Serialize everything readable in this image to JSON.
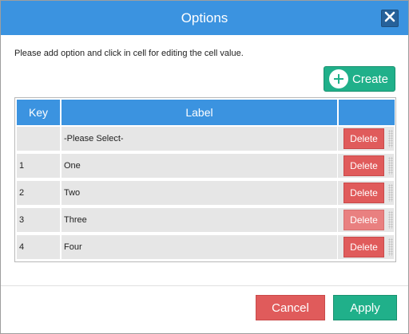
{
  "dialog": {
    "title": "Options",
    "instructions": "Please add option and click in cell for editing the cell value.",
    "create_label": "Create",
    "cancel_label": "Cancel",
    "apply_label": "Apply",
    "close_icon": "close-icon",
    "create_icon": "plus-circle-icon"
  },
  "table": {
    "headers": [
      "Key",
      "Label",
      ""
    ],
    "rows": [
      {
        "key": "",
        "label": "-Please Select-",
        "action": "Delete"
      },
      {
        "key": "1",
        "label": "One",
        "action": "Delete"
      },
      {
        "key": "2",
        "label": "Two",
        "action": "Delete"
      },
      {
        "key": "3",
        "label": "Three",
        "action": "Delete"
      },
      {
        "key": "4",
        "label": "Four",
        "action": "Delete"
      }
    ]
  },
  "colors": {
    "header_blue": "#3b93e0",
    "create_green": "#20b08a",
    "delete_red": "#e05b5b",
    "cell_gray": "#e6e6e6"
  }
}
